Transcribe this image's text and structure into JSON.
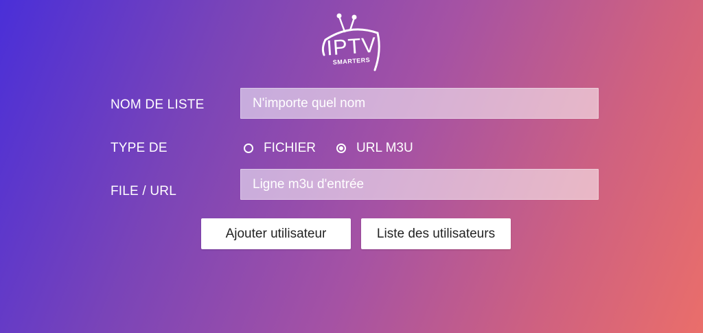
{
  "logo": {
    "title": "IPTV",
    "subtitle": "SMARTERS"
  },
  "form": {
    "list_name": {
      "label": "NOM DE LISTE",
      "placeholder": "N'importe quel nom",
      "value": ""
    },
    "type": {
      "label": "TYPE DE",
      "options": [
        {
          "label": "FICHIER",
          "selected": false
        },
        {
          "label": "URL M3U",
          "selected": true
        }
      ]
    },
    "file_url": {
      "label": "FILE / URL",
      "placeholder": "Ligne m3u d'entrée",
      "value": ""
    }
  },
  "buttons": {
    "add_user": "Ajouter utilisateur",
    "user_list": "Liste des utilisateurs"
  },
  "colors": {
    "gradient_start": "#4a2fd8",
    "gradient_mid": "#a552a4",
    "gradient_end": "#ea6e6a",
    "button_bg": "#ffffff",
    "button_text": "#222222"
  }
}
